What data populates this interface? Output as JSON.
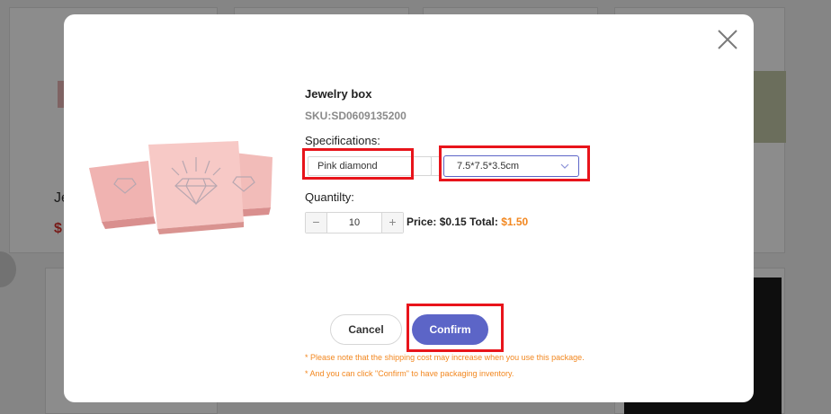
{
  "background": {
    "card_title_partial": "Je",
    "card_price_partial": "$"
  },
  "modal": {
    "close_icon": "close-icon",
    "product_title": "Jewelry box",
    "sku": "SKU:SD0609135200",
    "specifications_label": "Specifications:",
    "spec_primary_value": "Pink diamond",
    "spec_size_value": "7.5*7.5*3.5cm",
    "quantity_label": "Quantilty:",
    "quantity_value": "10",
    "minus_label": "−",
    "plus_label": "+",
    "price_label": "Price:",
    "price_value": "$0.15",
    "total_label": "Total:",
    "total_value": "$1.50",
    "cancel_label": "Cancel",
    "confirm_label": "Confirm",
    "note_1": "* Please note that the shipping cost may increase when you use this package.",
    "note_2": "* And you can click \"Confirm\" to have packaging inventory."
  },
  "colors": {
    "accent": "#5c65c7",
    "highlight": "#e8141b",
    "note_orange": "#f2871f",
    "total_orange": "#f2871f"
  }
}
